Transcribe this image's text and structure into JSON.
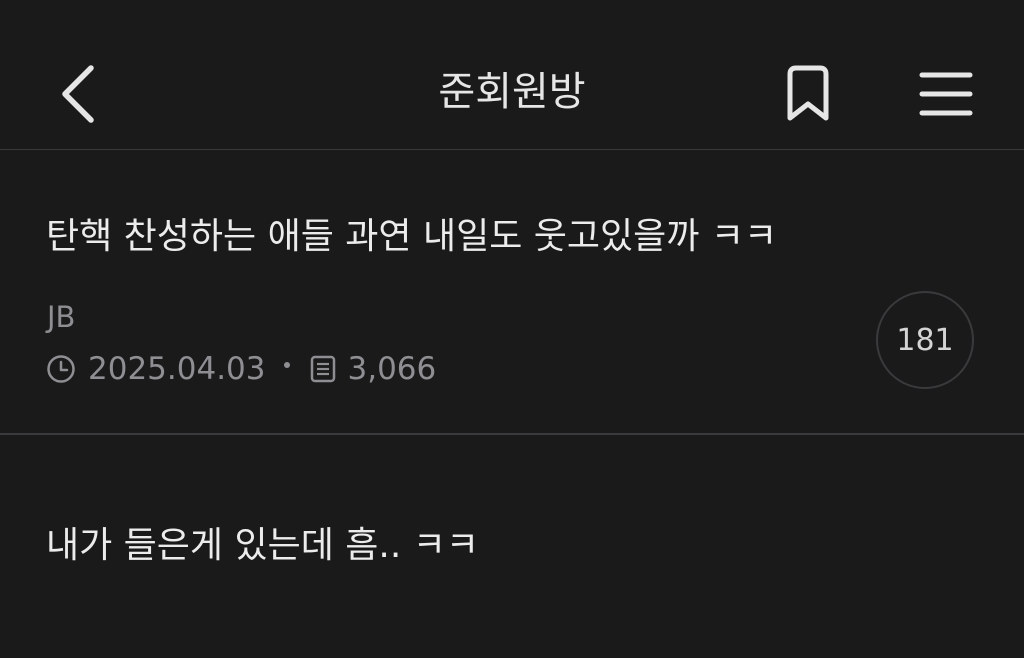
{
  "header": {
    "title": "준회원방",
    "icons": {
      "back": "chevron-left-icon",
      "bookmark": "bookmark-icon",
      "menu": "hamburger-menu-icon"
    }
  },
  "posts": [
    {
      "title": "탄핵 찬성하는 애들 과연 내일도 웃고있을까 ㅋㅋ",
      "author": "JB",
      "date": "2025.04.03",
      "views": "3,066",
      "comments": "181"
    },
    {
      "title": "내가 들은게 있는데 흠.. ㅋㅋ"
    }
  ],
  "colors": {
    "background": "#1a1a1b",
    "text": "#ececec",
    "muted": "#8e8e93",
    "divider": "#3a3a3c"
  }
}
